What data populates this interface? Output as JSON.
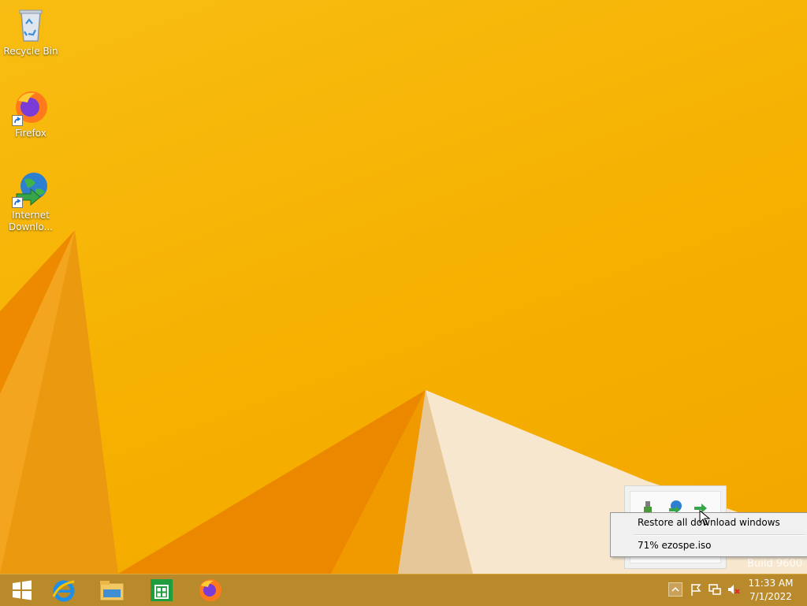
{
  "desktop": {
    "icons": [
      {
        "label": "Recycle Bin",
        "icon": "recycle-bin-icon"
      },
      {
        "label": "Firefox",
        "icon": "firefox-icon"
      },
      {
        "label": "Internet Downlo...",
        "icon": "internet-download-manager-icon"
      }
    ],
    "build_watermark": "Build 9600"
  },
  "context_menu": {
    "items": [
      {
        "label": "Restore all download windows"
      },
      {
        "label": "71% ezospe.iso"
      }
    ]
  },
  "tray_overflow": {
    "icons": [
      "usb-icon",
      "idm-globe-icon",
      "idm-arrow-icon"
    ]
  },
  "taskbar": {
    "pinned": [
      {
        "icon": "windows-start-icon"
      },
      {
        "icon": "internet-explorer-icon"
      },
      {
        "icon": "file-explorer-icon"
      },
      {
        "icon": "windows-store-icon"
      },
      {
        "icon": "firefox-icon"
      }
    ],
    "tray": [
      "show-hidden-icons-icon",
      "action-center-flag-icon",
      "network-icon",
      "volume-muted-icon"
    ],
    "clock": {
      "time": "11:33 AM",
      "date": "7/1/2022"
    }
  },
  "colors": {
    "wallpaper": "#f7b400",
    "taskbar": "#b88a2c"
  }
}
